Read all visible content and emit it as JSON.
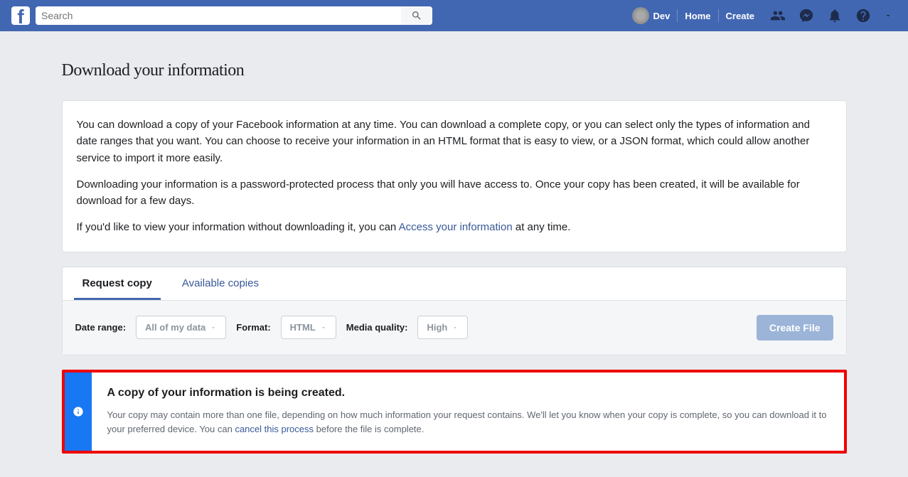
{
  "topbar": {
    "search_placeholder": "Search",
    "profile_name": "Dev",
    "nav_home": "Home",
    "nav_create": "Create"
  },
  "page": {
    "title": "Download your information",
    "intro_p1": "You can download a copy of your Facebook information at any time. You can download a complete copy, or you can select only the types of information and date ranges that you want. You can choose to receive your information in an HTML format that is easy to view, or a JSON format, which could allow another service to import it more easily.",
    "intro_p2": "Downloading your information is a password-protected process that only you will have access to. Once your copy has been created, it will be available for download for a few days.",
    "intro_p3_a": "If you'd like to view your information without downloading it, you can ",
    "intro_p3_link": "Access your information",
    "intro_p3_b": " at any time."
  },
  "tabs": {
    "request": "Request copy",
    "available": "Available copies"
  },
  "controls": {
    "date_label": "Date range:",
    "date_value": "All of my data",
    "format_label": "Format:",
    "format_value": "HTML",
    "quality_label": "Media quality:",
    "quality_value": "High",
    "create_btn": "Create File"
  },
  "notify": {
    "title": "A copy of your information is being created.",
    "text_a": "Your copy may contain more than one file, depending on how much information your request contains. We'll let you know when your copy is complete, so you can download it to your preferred device. You can ",
    "text_link": "cancel this process",
    "text_b": " before the file is complete."
  }
}
